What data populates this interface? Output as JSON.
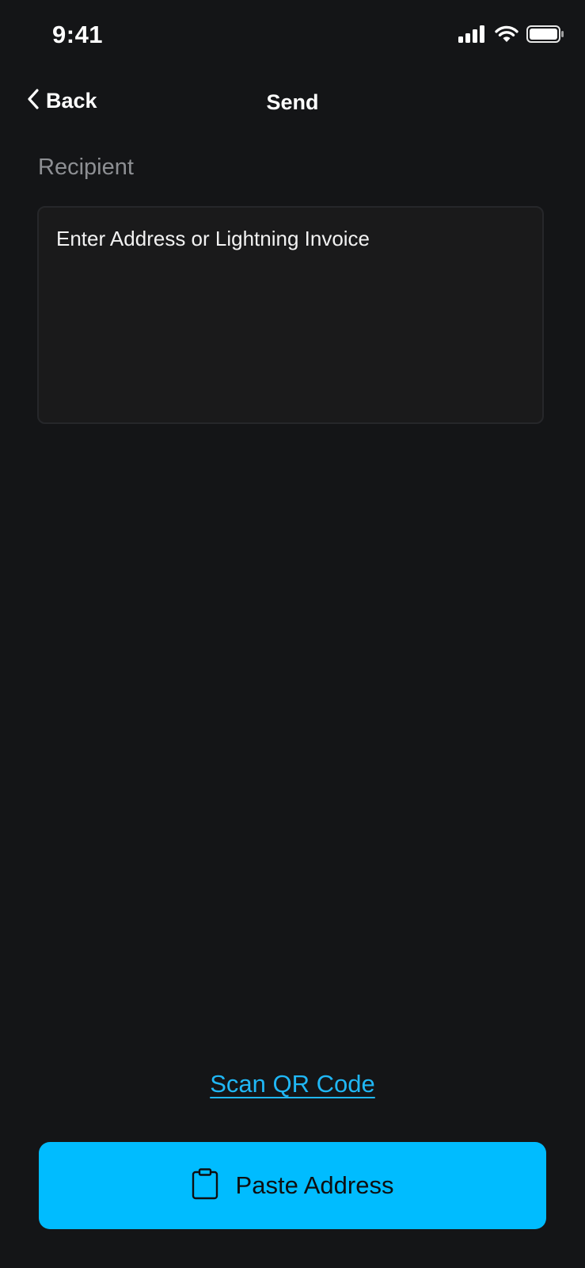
{
  "status_bar": {
    "time": "9:41",
    "icons": [
      "signal-icon",
      "wifi-icon",
      "battery-icon"
    ]
  },
  "nav": {
    "back_label": "Back",
    "title": "Send",
    "back_icon": "chevron-left-icon"
  },
  "recipient": {
    "label": "Recipient",
    "placeholder": "Enter Address or Lightning Invoice",
    "value": ""
  },
  "actions": {
    "scan_label": "Scan QR Code",
    "paste_label": "Paste Address",
    "paste_icon": "clipboard-icon"
  },
  "colors": {
    "background": "#141517",
    "accent": "#00bcff",
    "link": "#20b7f5",
    "muted_text": "#8d8f93"
  }
}
